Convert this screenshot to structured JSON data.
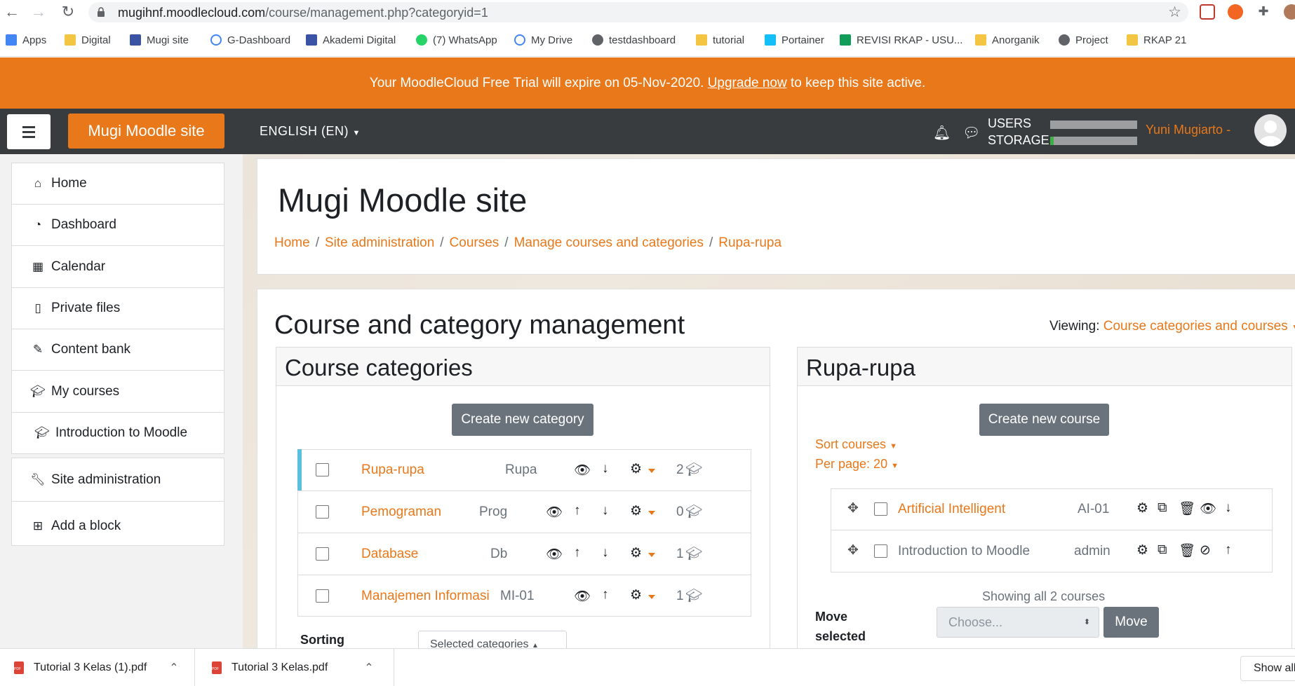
{
  "browser": {
    "url_host": "mugihnf.moodlecloud.com",
    "url_path": "/course/management.php?categoryid=1",
    "bookmarks": [
      {
        "label": "Apps",
        "icon": "apps-grid-icon"
      },
      {
        "label": "Digital",
        "icon": "folder-icon"
      },
      {
        "label": "Mugi site",
        "icon": "site-icon"
      },
      {
        "label": "G-Dashboard",
        "icon": "google-icon"
      },
      {
        "label": "Akademi Digital",
        "icon": "site-icon"
      },
      {
        "label": "(7) WhatsApp",
        "icon": "whatsapp-icon"
      },
      {
        "label": "My Drive",
        "icon": "google-icon"
      },
      {
        "label": "testdashboard",
        "icon": "globe-icon"
      },
      {
        "label": "tutorial",
        "icon": "folder-icon"
      },
      {
        "label": "Portainer",
        "icon": "portainer-icon"
      },
      {
        "label": "REVISI RKAP - USU...",
        "icon": "sheets-icon"
      },
      {
        "label": "Anorganik",
        "icon": "folder-icon"
      },
      {
        "label": "Project",
        "icon": "globe-icon"
      },
      {
        "label": "RKAP 21",
        "icon": "folder-icon"
      }
    ]
  },
  "banner": {
    "before": "Your MoodleCloud Free Trial will expire on 05-Nov-2020.",
    "link": "Upgrade now",
    "after": "to keep this site active."
  },
  "navbar": {
    "site_name": "Mugi Moodle site",
    "language": "ENGLISH (EN)",
    "usage_label_1": "USERS",
    "usage_label_2": "STORAGE",
    "user_name": "Yuni Mugiarto -"
  },
  "sidebar": {
    "items": [
      {
        "label": "Home",
        "icon": "home-icon"
      },
      {
        "label": "Dashboard",
        "icon": "dashboard-icon"
      },
      {
        "label": "Calendar",
        "icon": "calendar-icon"
      },
      {
        "label": "Private files",
        "icon": "file-icon"
      },
      {
        "label": "Content bank",
        "icon": "brush-icon"
      },
      {
        "label": "My courses",
        "icon": "graduation-cap-icon"
      },
      {
        "label": "Introduction to Moodle",
        "icon": "graduation-cap-icon"
      }
    ],
    "admin": [
      {
        "label": "Site administration",
        "icon": "wrench-icon"
      },
      {
        "label": "Add a block",
        "icon": "plus-square-icon"
      }
    ]
  },
  "header": {
    "title": "Mugi Moodle site",
    "breadcrumb": [
      "Home",
      "Site administration",
      "Courses",
      "Manage courses and categories",
      "Rupa-rupa"
    ]
  },
  "main": {
    "title": "Course and category management",
    "viewing_label": "Viewing:",
    "viewing_value": "Course categories and courses",
    "categories": {
      "heading": "Course categories",
      "create_button": "Create new category",
      "rows": [
        {
          "name": "Rupa-rupa",
          "idnumber": "Rupa",
          "count": "2"
        },
        {
          "name": "Pemograman",
          "idnumber": "Prog",
          "count": "0"
        },
        {
          "name": "Database",
          "idnumber": "Db",
          "count": "1"
        },
        {
          "name": "Manajemen Informasi",
          "idnumber": "MI-01",
          "count": "1"
        }
      ],
      "sorting_label": "Sorting",
      "sorting_select": "Selected categories"
    },
    "courses": {
      "heading": "Rupa-rupa",
      "create_button": "Create new course",
      "sort_label": "Sort courses",
      "per_page_label": "Per page: 20",
      "rows": [
        {
          "name": "Artificial Intelligent",
          "shortname": "AI-01"
        },
        {
          "name": "Introduction to Moodle",
          "shortname": "admin"
        }
      ],
      "showing": "Showing all 2 courses",
      "move_selected": "Move selected",
      "move_placeholder": "Choose...",
      "move_button": "Move"
    }
  },
  "downloads": {
    "items": [
      "Tutorial 3 Kelas (1).pdf",
      "Tutorial 3 Kelas.pdf"
    ],
    "show_all": "Show all"
  },
  "colors": {
    "accent": "#e8781a",
    "navbar": "#383c3f",
    "button_grey": "#6a737b"
  }
}
